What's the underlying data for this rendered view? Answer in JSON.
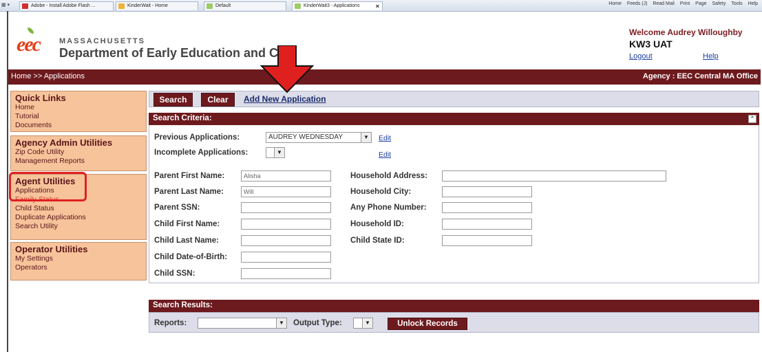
{
  "browser": {
    "tabs": [
      {
        "label": "Adobe - Install Adobe Flash ..."
      },
      {
        "label": "KinderWait - Home"
      },
      {
        "label": "Default"
      },
      {
        "label": "KinderWait3 - Applications"
      }
    ],
    "commands": [
      "Home",
      "Feeds (J)",
      "Read Mail",
      "Print",
      "Page",
      "Safety",
      "Tools",
      "Help"
    ]
  },
  "header": {
    "state": "MASSACHUSETTS",
    "department": "Department of Early Education and Ca",
    "logo_text": "eec",
    "welcome": "Welcome Audrey Willoughby",
    "environment": "KW3 UAT",
    "logout": "Logout",
    "help": "Help"
  },
  "topbar": {
    "breadcrumb": "Home >> Applications",
    "agency": "Agency : EEC Central MA Office"
  },
  "sidebar": {
    "quick_links": {
      "title": "Quick Links",
      "items": [
        "Home",
        "Tutorial",
        "Documents"
      ]
    },
    "agency_admin": {
      "title": "Agency Admin Utilities",
      "items": [
        "Zip Code Utility",
        "Management Reports"
      ]
    },
    "agent": {
      "title": "Agent Utilities",
      "items": [
        "Applications",
        "Family Status",
        "Child Status",
        "Duplicate Applications",
        "Search Utility"
      ]
    },
    "operator": {
      "title": "Operator Utilities",
      "items": [
        "My Settings",
        "Operators"
      ]
    }
  },
  "actions": {
    "search": "Search",
    "clear": "Clear",
    "add_new": "Add New Application"
  },
  "criteria": {
    "title": "Search Criteria:",
    "previous_label": "Previous Applications:",
    "previous_value": "AUDREY WEDNESDAY",
    "incomplete_label": "Incomplete Applications:",
    "edit": "Edit",
    "parent_first_label": "Parent First Name:",
    "parent_first_value": "Alisha",
    "parent_last_label": "Parent Last Name:",
    "parent_last_value": "Will",
    "parent_ssn_label": "Parent SSN:",
    "child_first_label": "Child First Name:",
    "child_last_label": "Child Last Name:",
    "child_dob_label": "Child Date-of-Birth:",
    "child_ssn_label": "Child SSN:",
    "household_address_label": "Household Address:",
    "household_city_label": "Household City:",
    "any_phone_label": "Any Phone Number:",
    "household_id_label": "Household ID:",
    "child_state_id_label": "Child State ID:"
  },
  "results": {
    "title": "Search Results:",
    "reports_label": "Reports:",
    "output_label": "Output Type:",
    "unlock": "Unlock Records"
  },
  "colors": {
    "maroon": "#6d1a1e",
    "sidebar": "#f6c39b",
    "highlight": "#e0201f"
  }
}
